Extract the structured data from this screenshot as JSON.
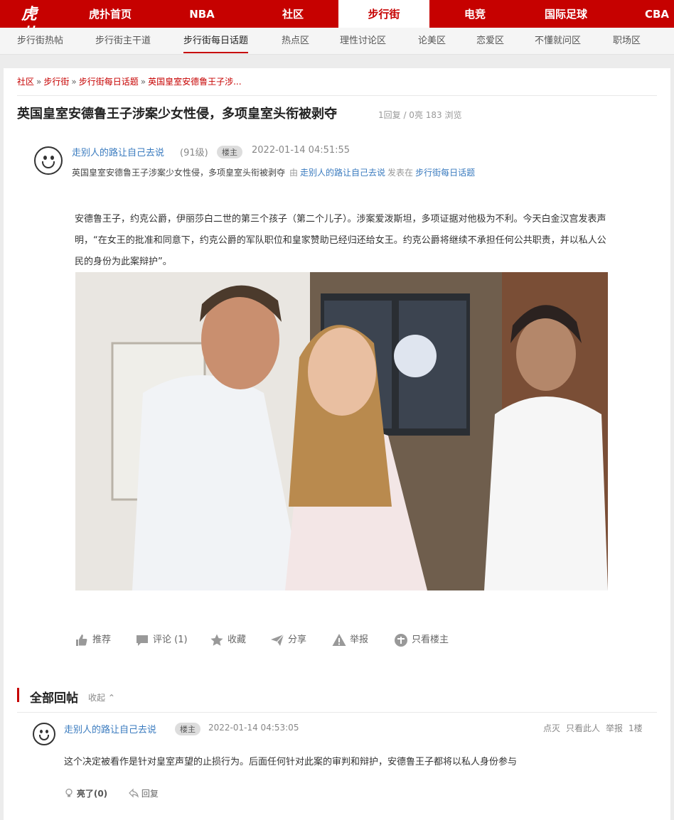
{
  "logo": "虎扑",
  "top_nav": {
    "items": [
      {
        "label": "虎扑首页"
      },
      {
        "label": "NBA"
      },
      {
        "label": "社区"
      },
      {
        "label": "步行街",
        "active": true
      },
      {
        "label": "电竞"
      },
      {
        "label": "国际足球"
      },
      {
        "label": "CBA"
      }
    ],
    "accent": "#c60100"
  },
  "sub_nav": {
    "items": [
      {
        "label": "步行街热帖"
      },
      {
        "label": "步行街主干道"
      },
      {
        "label": "步行街每日话题",
        "active": true
      },
      {
        "label": "热点区"
      },
      {
        "label": "理性讨论区"
      },
      {
        "label": "论美区"
      },
      {
        "label": "恋爱区"
      },
      {
        "label": "不懂就问区"
      },
      {
        "label": "职场区"
      }
    ]
  },
  "breadcrumb": {
    "items": [
      "社区",
      "步行街",
      "步行街每日话题",
      "英国皇室安德鲁王子涉..."
    ],
    "separator": "»"
  },
  "post": {
    "title": "英国皇室安德鲁王子涉案少女性侵，多项皇室头衔被剥夺",
    "stats": "1回复 / 0亮 183 浏览",
    "author": "走别人的路让自己去说",
    "level": "(91级)",
    "badge": "楼主",
    "time": "2022-01-14 04:51:55",
    "subline_title": "英国皇室安德鲁王子涉案少女性侵，多项皇室头衔被剥夺",
    "subline_by": "由",
    "subline_author": "走别人的路让自己去说",
    "subline_published": "发表在",
    "subline_board": "步行街每日话题",
    "body": "安德鲁王子，约克公爵，伊丽莎白二世的第三个孩子（第二个儿子）。涉案爱泼斯坦，多项证据对他极为不利。今天白金汉宫发表声明，“在女王的批准和同意下，约克公爵的军队职位和皇家赞助已经归还给女王。约克公爵将继续不承担任何公共职责，并以私人公民的身份为此案辩护”。",
    "actions": [
      {
        "icon": "thumb-up-icon",
        "label": "推荐"
      },
      {
        "icon": "comment-icon",
        "label": "评论 (1)"
      },
      {
        "icon": "star-icon",
        "label": "收藏"
      },
      {
        "icon": "share-icon",
        "label": "分享"
      },
      {
        "icon": "warning-icon",
        "label": "举报"
      },
      {
        "icon": "host-only-icon",
        "label": "只看楼主"
      }
    ]
  },
  "replies": {
    "section_title": "全部回帖",
    "collapse_label": "收起",
    "items": [
      {
        "author": "走别人的路让自己去说",
        "badge": "楼主",
        "time": "2022-01-14 04:53:05",
        "tools": [
          "点灭",
          "只看此人",
          "举报",
          "1楼"
        ],
        "text": "这个决定被看作是针对皇室声望的止损行为。后面任何针对此案的审判和辩护，安德鲁王子都将以私人身份参与",
        "light_label": "亮了",
        "light_count": "(0)",
        "reply_label": "回复"
      }
    ]
  }
}
